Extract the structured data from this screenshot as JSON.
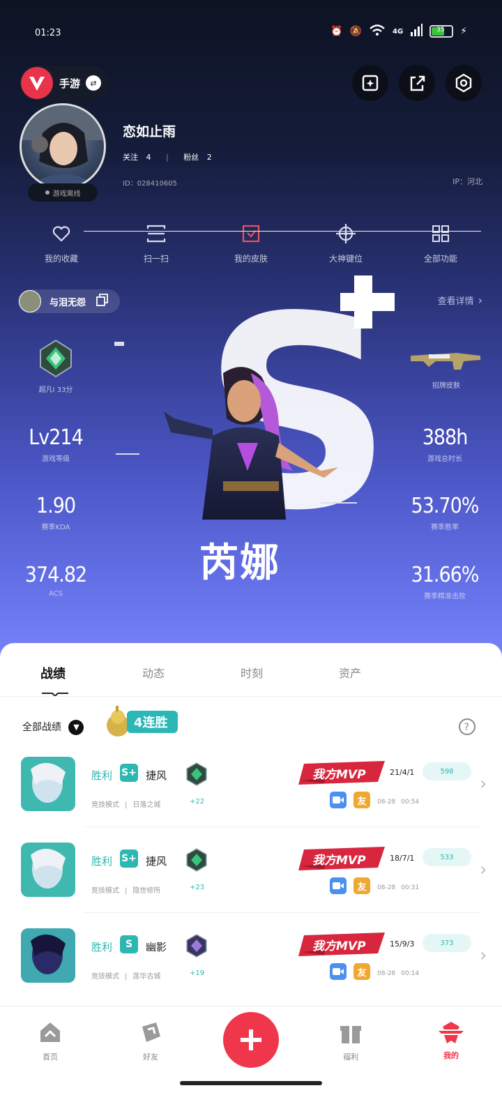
{
  "status_bar": {
    "time": "01:23",
    "signal": "4G",
    "battery": "35"
  },
  "header": {
    "mode_label": "手游",
    "mode_switch_icon": "swap-icon"
  },
  "profile": {
    "name": "恋如止雨",
    "follow_label": "关注",
    "follow_count": "4",
    "fans_label": "粉丝",
    "fans_count": "2",
    "id_text": "ID：028410605",
    "ip_text": "IP：河北",
    "online_status": "游戏离线"
  },
  "quick_actions": [
    {
      "label": "我的收藏",
      "icon": "heart-icon"
    },
    {
      "label": "扫一扫",
      "icon": "scan-icon"
    },
    {
      "label": "我的皮肤",
      "icon": "skin-icon"
    },
    {
      "label": "大神键位",
      "icon": "crosshair-icon"
    },
    {
      "label": "全部功能",
      "icon": "grid-icon"
    }
  ],
  "friend": {
    "name": "与泪无怨"
  },
  "view_detail": "查看详情",
  "stats": {
    "rank_label": "超凡Ⅰ 33分",
    "skin_label": "招牌皮肤",
    "level_value": "Lv214",
    "level_label": "游戏等级",
    "hours_value": "388h",
    "hours_label": "游戏总时长",
    "kda_value": "1.90",
    "kda_label": "赛季KDA",
    "winrate_value": "53.70%",
    "winrate_label": "赛季胜率",
    "acs_value": "374.82",
    "acs_label": "ACS",
    "headshot_value": "31.66%",
    "headshot_label": "赛季精准击败"
  },
  "hero": {
    "grade": "S+",
    "name": "芮娜"
  },
  "tabs": [
    "战绩",
    "动态",
    "时刻",
    "资产"
  ],
  "filter": {
    "label": "全部战绩",
    "streak": "4连胜"
  },
  "matches": [
    {
      "result": "胜利",
      "grade": "S+",
      "agent": "捷风",
      "mode": "竞技模式",
      "map": "日落之城",
      "rank_delta": "+22",
      "mvp": "我方MVP",
      "kda": "21/4/1",
      "score": "598",
      "date": "08-28",
      "duration": "00:54"
    },
    {
      "result": "胜利",
      "grade": "S+",
      "agent": "捷风",
      "mode": "竞技模式",
      "map": "隐世修所",
      "rank_delta": "+23",
      "mvp": "我方MVP",
      "kda": "18/7/1",
      "score": "533",
      "date": "08-28",
      "duration": "00:31"
    },
    {
      "result": "胜利",
      "grade": "S",
      "agent": "幽影",
      "mode": "竞技模式",
      "map": "莲华古城",
      "rank_delta": "+19",
      "mvp": "我方MVP",
      "kda": "15/9/3",
      "score": "373",
      "date": "08-28",
      "duration": "00:14"
    }
  ],
  "friend_badge": "友",
  "bottom_nav": [
    {
      "label": "首页",
      "icon": "home-icon"
    },
    {
      "label": "好友",
      "icon": "friends-icon"
    },
    {
      "label": "",
      "icon": "plus-icon"
    },
    {
      "label": "福利",
      "icon": "gift-icon"
    },
    {
      "label": "我的",
      "icon": "profile-icon"
    }
  ],
  "colors": {
    "accent": "#f0364a",
    "teal": "#2db7b0",
    "hero_bg": "#6b78f0"
  }
}
